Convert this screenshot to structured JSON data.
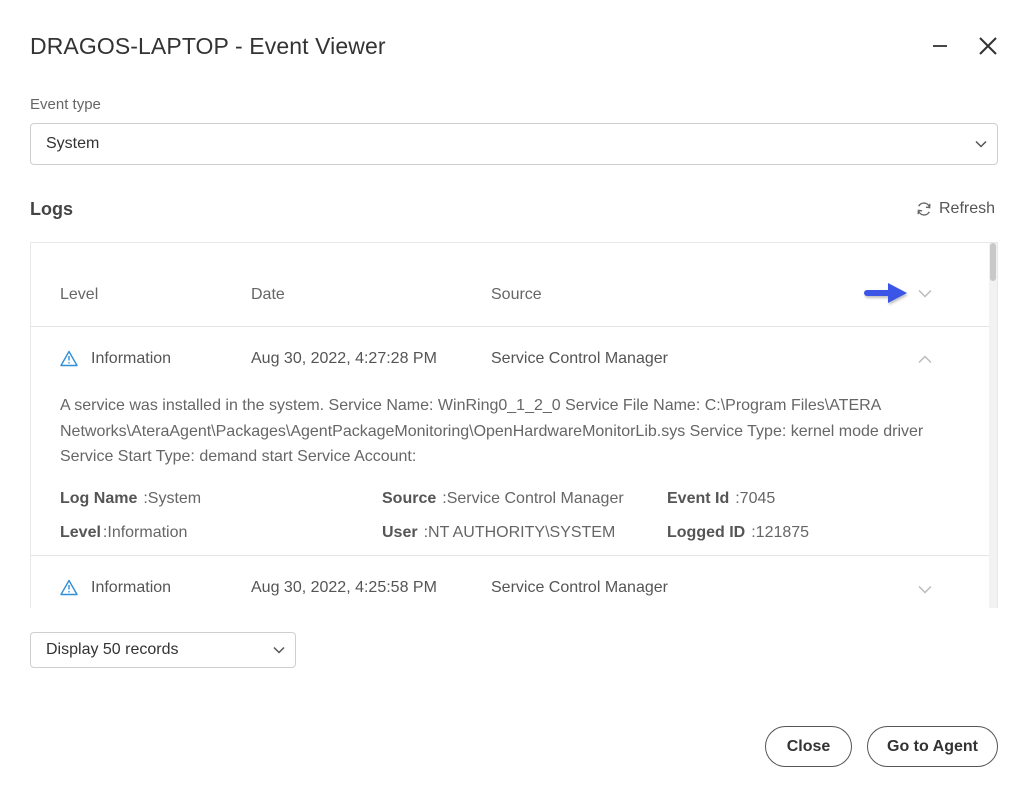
{
  "window": {
    "title": "DRAGOS-LAPTOP - Event Viewer"
  },
  "event_type": {
    "label": "Event type",
    "selected": "System"
  },
  "logs": {
    "title": "Logs",
    "refresh_label": "Refresh",
    "columns": {
      "level": "Level",
      "date": "Date",
      "source": "Source"
    },
    "rows": [
      {
        "level": "Information",
        "date": "Aug 30, 2022, 4:27:28 PM",
        "source": "Service Control Manager",
        "expanded": true,
        "description": "A service was installed in the system. Service Name: WinRing0_1_2_0 Service File Name: C:\\Program Files\\ATERA Networks\\AteraAgent\\Packages\\AgentPackageMonitoring\\OpenHardwareMonitorLib.sys Service Type: kernel mode driver Service Start Type: demand start Service Account:",
        "details": {
          "log_name_label": "Log Name",
          "log_name_value": ":System",
          "source_label": "Source",
          "source_value": ":Service Control Manager",
          "event_id_label": "Event Id",
          "event_id_value": ":7045",
          "level_label": "Level",
          "level_value": ":Information",
          "user_label": "User",
          "user_value": ":NT AUTHORITY\\SYSTEM",
          "logged_id_label": "Logged ID",
          "logged_id_value": ":121875"
        }
      },
      {
        "level": "Information",
        "date": "Aug 30, 2022, 4:25:58 PM",
        "source": "Service Control Manager",
        "expanded": false
      }
    ]
  },
  "records": {
    "selected": "Display 50 records"
  },
  "footer": {
    "close_label": "Close",
    "agent_label": "Go to Agent"
  },
  "colors": {
    "info_icon": "#2f8fd8",
    "annotation_arrow": "#3b55e6",
    "border": "#cfcfcf"
  }
}
